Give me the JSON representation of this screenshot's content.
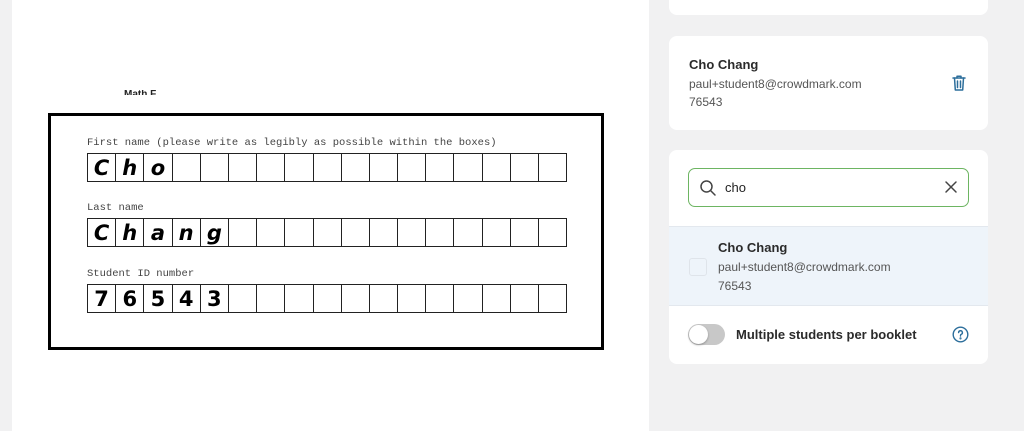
{
  "document": {
    "clipped_heading": "Math F",
    "first_name_label": "First name (please write as legibly as possible within the boxes)",
    "last_name_label": "Last name",
    "student_id_label": "Student ID number",
    "first_name_chars": [
      "C",
      "h",
      "o",
      "",
      "",
      "",
      "",
      "",
      "",
      "",
      "",
      "",
      "",
      "",
      "",
      "",
      ""
    ],
    "last_name_chars": [
      "C",
      "h",
      "a",
      "n",
      "g",
      "",
      "",
      "",
      "",
      "",
      "",
      "",
      "",
      "",
      "",
      "",
      ""
    ],
    "student_id_chars": [
      "7",
      "6",
      "5",
      "4",
      "3",
      "",
      "",
      "",
      "",
      "",
      "",
      "",
      "",
      "",
      "",
      "",
      ""
    ]
  },
  "matched_student": {
    "name": "Cho Chang",
    "email": "paul+student8@crowdmark.com",
    "id": "76543",
    "remove_icon": "trash-icon"
  },
  "search": {
    "value": "cho",
    "search_icon": "magnifier",
    "clear_icon": "x"
  },
  "results": [
    {
      "name": "Cho Chang",
      "email": "paul+student8@crowdmark.com",
      "id": "76543"
    }
  ],
  "multi_student": {
    "label": "Multiple students per booklet",
    "enabled": false
  },
  "colors": {
    "accent_green": "#6db562",
    "icon_blue": "#2c6e9b",
    "result_highlight": "#eef4fa"
  }
}
